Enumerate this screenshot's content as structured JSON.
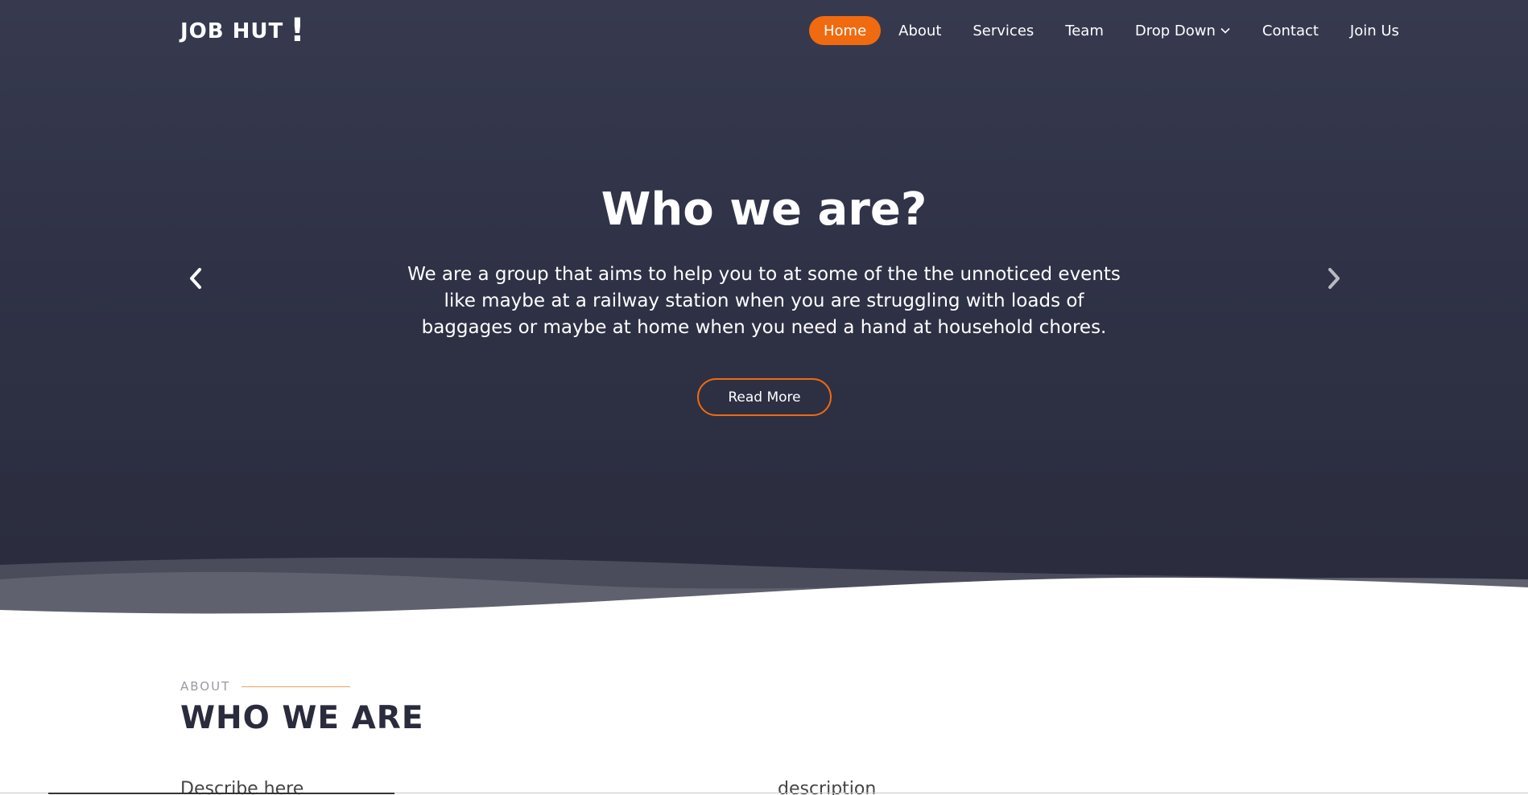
{
  "brand": {
    "name": "JOB HUT",
    "mark": "!"
  },
  "nav": {
    "items": [
      {
        "label": "Home",
        "active": true
      },
      {
        "label": "About"
      },
      {
        "label": "Services"
      },
      {
        "label": "Team"
      },
      {
        "label": "Drop Down",
        "has_dropdown": true
      },
      {
        "label": "Contact"
      },
      {
        "label": "Join Us"
      }
    ]
  },
  "hero": {
    "title": "Who we are?",
    "text": "We are a group that aims to help you to at some of the the unnoticed events like maybe at a railway station when you are struggling with loads of baggages or maybe at home when you need a hand at household chores.",
    "button_label": "Read More",
    "prev_icon": "chevron-left-icon",
    "next_icon": "chevron-right-icon"
  },
  "about": {
    "label": "ABOUT",
    "title": "WHO WE ARE",
    "left_text": "Describe here",
    "right_text": "description"
  },
  "colors": {
    "hero_bg": "#2f3246",
    "accent": "#f06a0f",
    "heading_dark": "#2a2c3d"
  }
}
